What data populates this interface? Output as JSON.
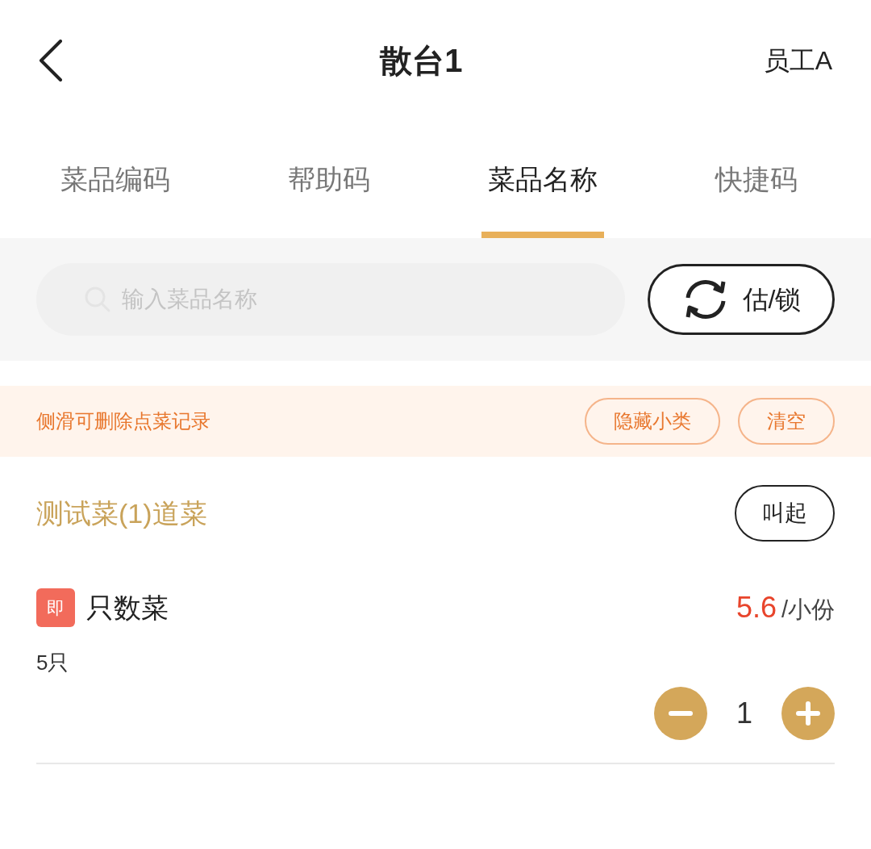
{
  "header": {
    "title": "散台1",
    "user": "员工A"
  },
  "tabs": [
    {
      "label": "菜品编码",
      "selected": false
    },
    {
      "label": "帮助码",
      "selected": false
    },
    {
      "label": "菜品名称",
      "selected": true
    },
    {
      "label": "快捷码",
      "selected": false
    }
  ],
  "search": {
    "placeholder": "输入菜品名称"
  },
  "lock_button": "估/锁",
  "notice": {
    "text": "侧滑可删除点菜记录",
    "buttons": [
      "隐藏小类",
      "清空"
    ]
  },
  "category": {
    "title": "测试菜(1)道菜",
    "action": "叫起"
  },
  "dishes": [
    {
      "badge": "即",
      "name": "只数菜",
      "price": "5.6",
      "unit": "/小份",
      "spec": "5只",
      "quantity": "1"
    }
  ]
}
